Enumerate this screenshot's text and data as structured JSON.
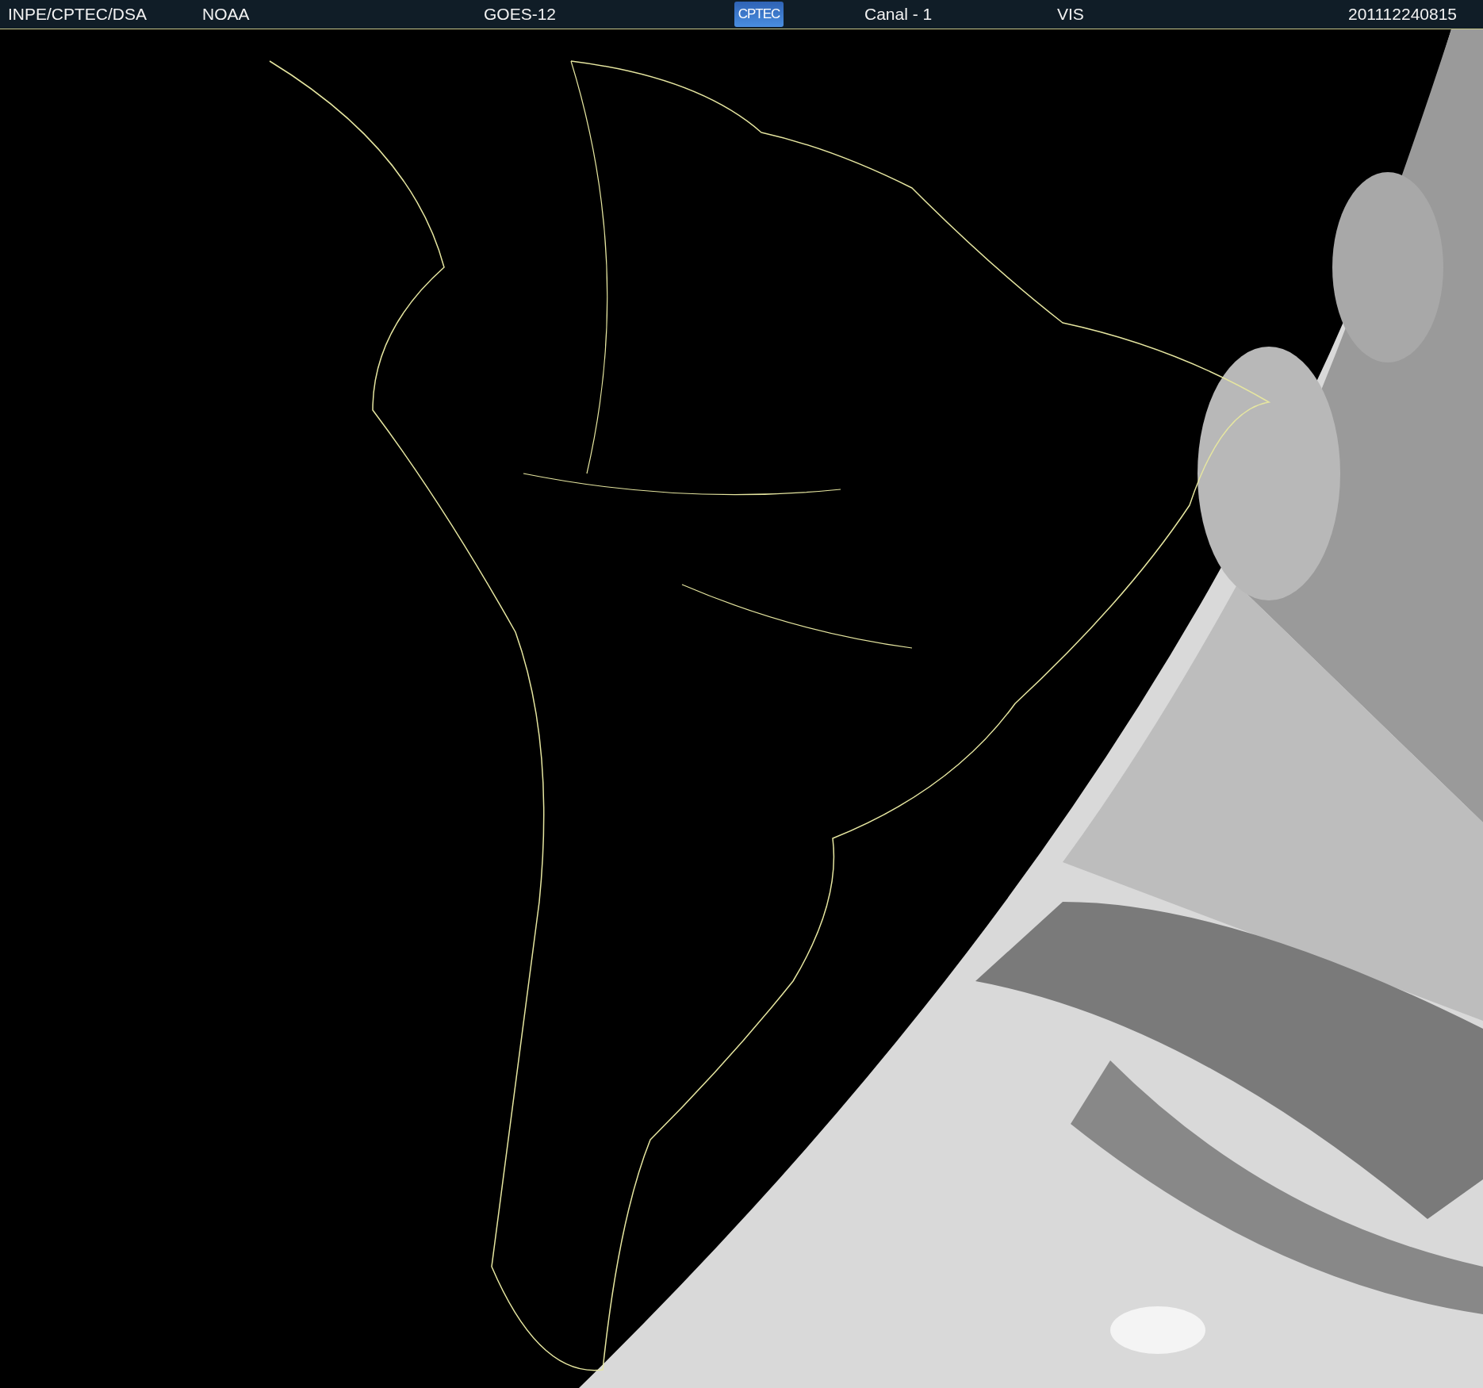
{
  "header": {
    "items": [
      {
        "kind": "text",
        "text": "INPE/CPTEC/DSA"
      },
      {
        "kind": "text",
        "text": "NOAA"
      },
      {
        "kind": "text",
        "text": "GOES-12"
      },
      {
        "kind": "logo",
        "text": "CPTEC"
      },
      {
        "kind": "text",
        "text": "Canal - 1"
      },
      {
        "kind": "text",
        "text": "VIS"
      },
      {
        "kind": "text",
        "text": "201112240815"
      }
    ]
  }
}
